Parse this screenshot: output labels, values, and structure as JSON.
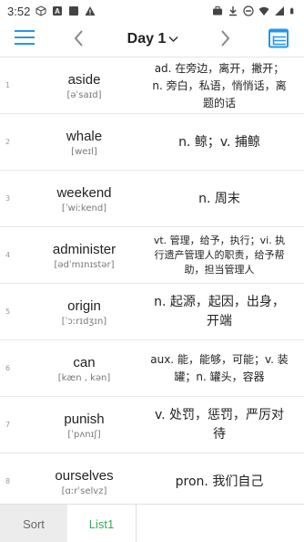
{
  "status_bar": {
    "time": "3:52"
  },
  "toolbar": {
    "day_label": "Day 1",
    "accent_color": "#2196F3"
  },
  "words": [
    {
      "num": "1",
      "word": "aside",
      "phonetic": "[əˈsaɪd]",
      "meaning": "ad. 在旁边，离开，撇开；n. 旁白，私语，悄悄话，离题的话",
      "size": "small"
    },
    {
      "num": "2",
      "word": "whale",
      "phonetic": "[weɪl]",
      "meaning": "n. 鲸；v. 捕鲸",
      "size": "big"
    },
    {
      "num": "3",
      "word": "weekend",
      "phonetic": "[ˈwiːkend]",
      "meaning": "n. 周末",
      "size": "big"
    },
    {
      "num": "4",
      "word": "administer",
      "phonetic": "[ədˈmɪnɪstər]",
      "meaning": "vt. 管理，给予，执行；vi. 执行遗产管理人的职责，给予帮助，担当管理人",
      "size": "xs"
    },
    {
      "num": "5",
      "word": "origin",
      "phonetic": "[ˈɔːrɪdʒɪn]",
      "meaning": "n. 起源，起因，出身，开端",
      "size": "big"
    },
    {
      "num": "6",
      "word": "can",
      "phonetic": "[kæn , kən]",
      "meaning": "aux. 能，能够，可能；v. 装罐；n. 罐头，容器",
      "size": "small"
    },
    {
      "num": "7",
      "word": "punish",
      "phonetic": "[ˈpʌnɪʃ]",
      "meaning": "v. 处罚，惩罚，严厉对待",
      "size": "big"
    },
    {
      "num": "8",
      "word": "ourselves",
      "phonetic": "[ɑːrˈselvz]",
      "meaning": "pron. 我们自己",
      "size": "big"
    }
  ],
  "tabs": {
    "sort": "Sort",
    "list1": "List1",
    "active_color": "#3aa857"
  }
}
